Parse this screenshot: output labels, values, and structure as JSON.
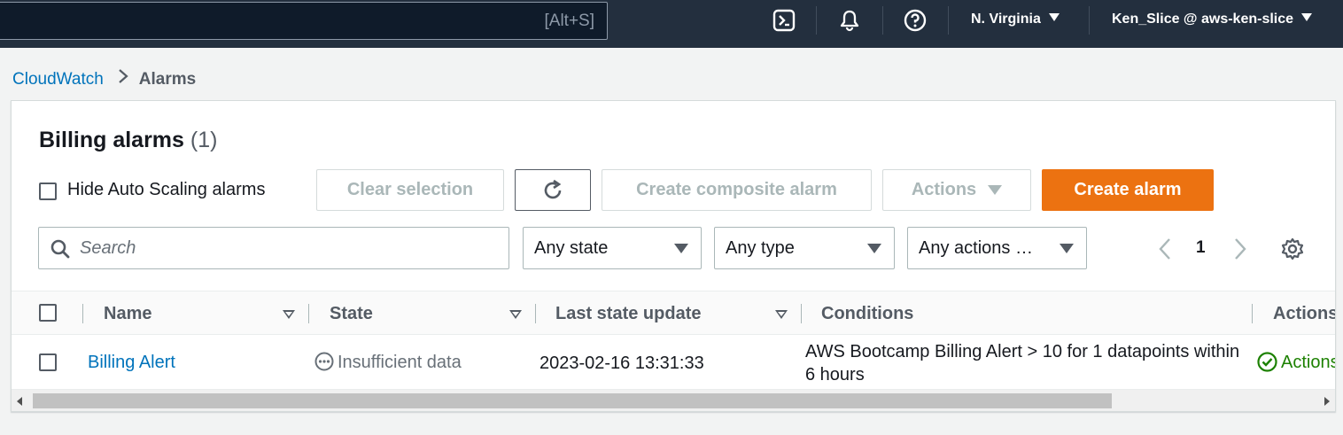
{
  "topbar": {
    "search_shortcut": "[Alt+S]",
    "region_label": "N. Virginia",
    "account_label": "Ken_Slice @ aws-ken-slice"
  },
  "breadcrumb": {
    "parent": "CloudWatch",
    "current": "Alarms"
  },
  "panel": {
    "title": "Billing alarms",
    "count": "(1)",
    "hide_autoscaling_label": "Hide Auto Scaling alarms",
    "hide_autoscaling_checked": false,
    "clear_selection_label": "Clear selection",
    "create_composite_label": "Create composite alarm",
    "actions_label": "Actions",
    "create_alarm_label": "Create alarm",
    "search_placeholder": "Search",
    "state_filter": "Any state",
    "type_filter": "Any type",
    "actions_filter": "Any actions …",
    "current_page": "1"
  },
  "table": {
    "columns": [
      "Name",
      "State",
      "Last state update",
      "Conditions",
      "Actions"
    ],
    "rows": [
      {
        "name": "Billing Alert",
        "state": "Insufficient data",
        "last_update": "2023-02-16 13:31:33",
        "conditions": "AWS Bootcamp Billing Alert > 10 for 1 datapoints within 6 hours",
        "actions": "Actions"
      }
    ]
  },
  "colors": {
    "topbar_bg": "#232f3e",
    "link": "#0073bb",
    "primary_button": "#ec7211",
    "success": "#1d8102"
  }
}
